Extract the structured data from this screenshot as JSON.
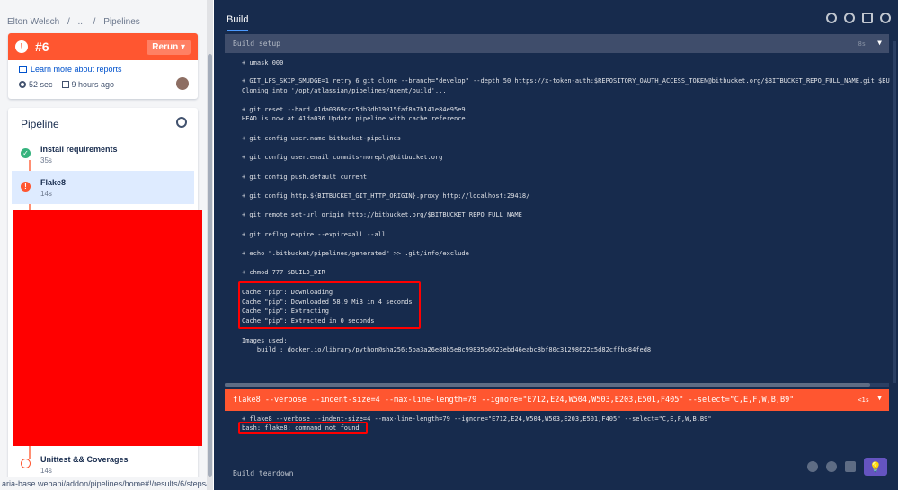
{
  "breadcrumb": {
    "owner": "Elton Welsch",
    "sep1": "/",
    "middle": "...",
    "sep2": "/",
    "page": "Pipelines"
  },
  "run": {
    "number": "#6",
    "rerun_label": "Rerun",
    "rerun_chevron": "▾",
    "status_icon": "!",
    "learn_label": "Learn more about reports",
    "duration": "52 sec",
    "ago": "9 hours ago"
  },
  "pipeline": {
    "title": "Pipeline",
    "steps": [
      {
        "name": "Install requirements",
        "duration": "35s",
        "status_icon": "✓"
      },
      {
        "name": "Flake8",
        "duration": "14s",
        "status_icon": "!"
      },
      {
        "name": "Unittest && Coverages",
        "duration": "14s",
        "status_icon": "!"
      }
    ]
  },
  "statusbar": "aria-base.webapi/addon/pipelines/home#!/results/6/steps/%7...",
  "build": {
    "tab_label": "Build",
    "setup_title": "Build setup",
    "setup_duration": "8s",
    "setup_lines": [
      "+ umask 000",
      "+ GIT_LFS_SKIP_SMUDGE=1 retry 6 git clone --branch=\"develop\" --depth 50 https://x-token-auth:$REPOSITORY_OAUTH_ACCESS_TOKEN@bitbucket.org/$BITBUCKET_REPO_FULL_NAME.git $BU",
      "Cloning into '/opt/atlassian/pipelines/agent/build'...",
      "+ git reset --hard 41da0369ccc5db3db19015faf8a7b141e84e95e9",
      "HEAD is now at 41da036 Update pipeline with cache reference",
      "+ git config user.name bitbucket-pipelines",
      "+ git config user.email commits-noreply@bitbucket.org",
      "+ git config push.default current",
      "+ git config http.${BITBUCKET_GIT_HTTP_ORIGIN}.proxy http://localhost:29418/",
      "+ git remote set-url origin http://bitbucket.org/$BITBUCKET_REPO_FULL_NAME",
      "+ git reflog expire --expire=all --all",
      "+ echo \".bitbucket/pipelines/generated\" >> .git/info/exclude",
      "+ chmod 777 $BUILD_DIR",
      "Cache \"pip\": Downloading",
      "Cache \"pip\": Downloaded 58.9 MiB in 4 seconds",
      "Cache \"pip\": Extracting",
      "Cache \"pip\": Extracted in 0 seconds",
      "Images used:",
      "    build : docker.io/library/python@sha256:5ba3a26e88b5e8c99835b6623ebd46eabc8bf80c31298622c5d82cffbc84fed8"
    ],
    "flake8_title": "flake8 --verbose --indent-size=4 --max-line-length=79 --ignore=\"E712,E24,W504,W503,E203,E501,F405\" --select=\"C,E,F,W,B,B9\"",
    "flake8_duration": "<1s",
    "flake8_lines": [
      "+ flake8 --verbose --indent-size=4 --max-line-length=79 --ignore=\"E712,E24,W504,W503,E203,E501,F405\" --select=\"C,E,F,W,B,B9\"",
      "bash: flake8: command not found"
    ],
    "teardown_title": "Build teardown"
  },
  "icons": {
    "toolbar": [
      "search-icon",
      "download-icon",
      "delete-icon",
      "info-icon"
    ],
    "bottom": [
      "scroll-down-icon",
      "scroll-up-icon",
      "expand-icon",
      "lightbulb-icon"
    ]
  },
  "colors": {
    "error": "#ff5630",
    "success": "#36b37e",
    "log_bg": "#172b4d",
    "link": "#0052cc",
    "highlight": "#ff0000"
  }
}
